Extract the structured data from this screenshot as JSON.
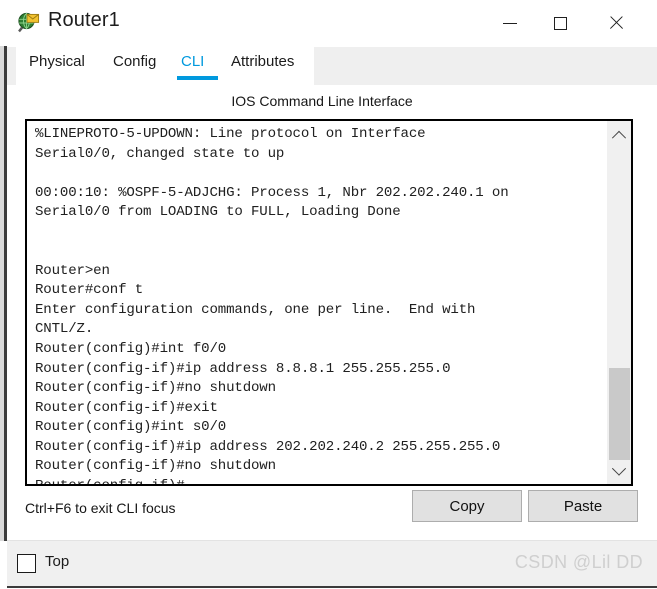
{
  "window": {
    "title": "Router1",
    "icon": "router-device-icon",
    "controls": {
      "minimize": "minimize-icon",
      "maximize": "maximize-icon",
      "close": "close-icon"
    }
  },
  "tabs": [
    {
      "label": "Physical",
      "active": false
    },
    {
      "label": "Config",
      "active": false
    },
    {
      "label": "CLI",
      "active": true
    },
    {
      "label": "Attributes",
      "active": false
    }
  ],
  "panel": {
    "title": "IOS Command Line Interface",
    "terminal_text": "%LINEPROTO-5-UPDOWN: Line protocol on Interface\nSerial0/0, changed state to up\n\n00:00:10: %OSPF-5-ADJCHG: Process 1, Nbr 202.202.240.1 on\nSerial0/0 from LOADING to FULL, Loading Done\n\n\nRouter>en\nRouter#conf t\nEnter configuration commands, one per line.  End with\nCNTL/Z.\nRouter(config)#int f0/0\nRouter(config-if)#ip address 8.8.8.1 255.255.255.0\nRouter(config-if)#no shutdown\nRouter(config-if)#exit\nRouter(config)#int s0/0\nRouter(config-if)#ip address 202.202.240.2 255.255.255.0\nRouter(config-if)#no shutdown\nRouter(config-if)#"
  },
  "scrollbar": {
    "up_icon": "chevron-up-icon",
    "down_icon": "chevron-down-icon"
  },
  "footer": {
    "hint": "Ctrl+F6 to exit CLI focus",
    "copy_label": "Copy",
    "paste_label": "Paste"
  },
  "bottom": {
    "top_checkbox_label": "Top",
    "top_checkbox_checked": false,
    "watermark": "CSDN @Lil DD"
  },
  "colors": {
    "accent_blue": "#0099de",
    "window_bg": "#ffffff",
    "chrome_gray": "#f0f0f0",
    "button_face": "#e1e1e1",
    "scroll_thumb": "#c9c9c9"
  }
}
